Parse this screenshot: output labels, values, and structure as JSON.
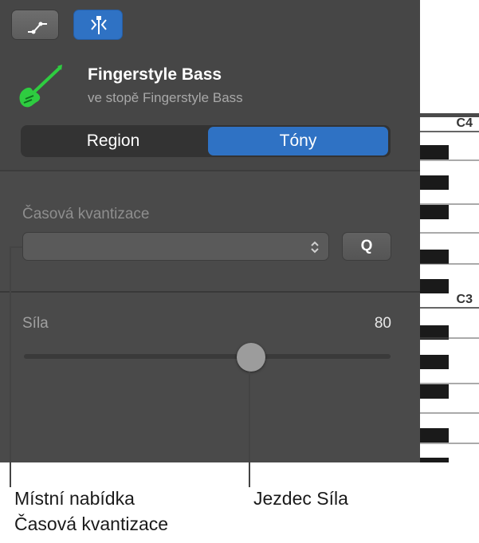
{
  "header": {
    "buttons": [
      {
        "name": "automation-button",
        "icon": "automation-curve-icon"
      },
      {
        "name": "piano-roll-button",
        "icon": "piano-roll-icon",
        "active": true
      }
    ]
  },
  "track": {
    "title": "Fingerstyle Bass",
    "subtitle": "ve stopě Fingerstyle Bass",
    "icon": "bass-guitar-icon",
    "icon_color": "#2ecc40"
  },
  "tabs": [
    {
      "label": "Region",
      "selected": false
    },
    {
      "label": "Tóny",
      "selected": true
    }
  ],
  "quantize": {
    "label": "Časová kvantizace",
    "value": "",
    "button_label": "Q"
  },
  "velocity": {
    "label": "Síla",
    "value": "80",
    "slider_fraction": 0.62
  },
  "keyboard": {
    "labels": [
      "C4",
      "C3"
    ]
  },
  "callouts": {
    "left": "Místní nabídka\nČasová kvantizace",
    "right": "Jezdec Síla"
  },
  "colors": {
    "accent": "#2f72c4",
    "panel": "#4a4a4a"
  }
}
